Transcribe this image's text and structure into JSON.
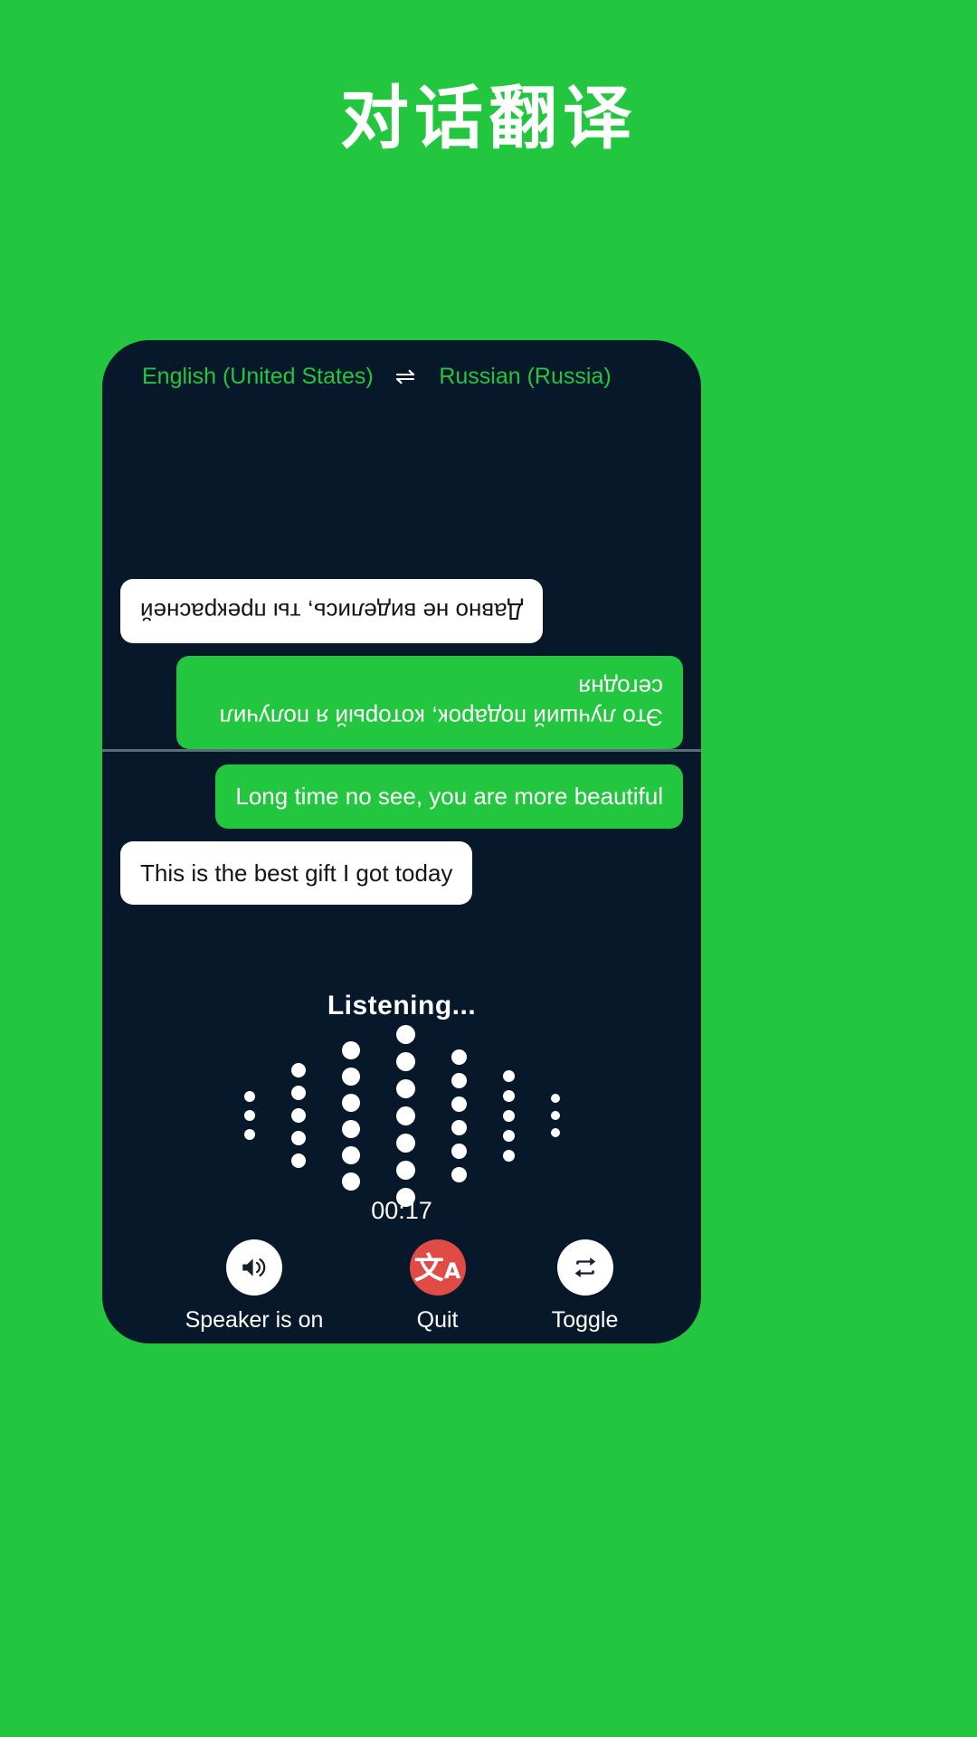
{
  "header": {
    "title": "对话翻译"
  },
  "languages": {
    "source": "English (United States)",
    "swap_icon": "⇌",
    "target": "Russian (Russia)"
  },
  "conversation": {
    "top_pane_rotated": true,
    "top_messages": [
      {
        "side": "left",
        "style": "green",
        "text": "Это лучший подарок, который я получил сегодня"
      },
      {
        "side": "right",
        "style": "white",
        "text": "Давно не виделись, ты прекрасней"
      }
    ],
    "bottom_messages": [
      {
        "side": "right",
        "style": "green",
        "text": "Long time no see, you are more beautiful"
      },
      {
        "side": "left",
        "style": "white",
        "text": "This is the best gift I got today"
      }
    ]
  },
  "status": {
    "listening_label": "Listening...",
    "timer": "00:17"
  },
  "waveform": {
    "columns": [
      {
        "dots": 3,
        "size": 12
      },
      {
        "dots": 5,
        "size": 16
      },
      {
        "dots": 6,
        "size": 20
      },
      {
        "dots": 7,
        "size": 21
      },
      {
        "dots": 6,
        "size": 17
      },
      {
        "dots": 5,
        "size": 13
      },
      {
        "dots": 3,
        "size": 10
      }
    ]
  },
  "controls": [
    {
      "name": "speaker",
      "label": "Speaker is on",
      "icon": "speaker-on-icon",
      "circle": "white"
    },
    {
      "name": "quit",
      "label": "Quit",
      "icon": "translate-icon",
      "circle": "red"
    },
    {
      "name": "toggle",
      "label": "Toggle",
      "icon": "repeat-icon",
      "circle": "white"
    }
  ],
  "colors": {
    "brand_green": "#22c63f",
    "card_dark": "#07182b",
    "accent_red": "#e04b46",
    "bubble_white": "#ffffff",
    "divider": "#5b6b7a"
  }
}
